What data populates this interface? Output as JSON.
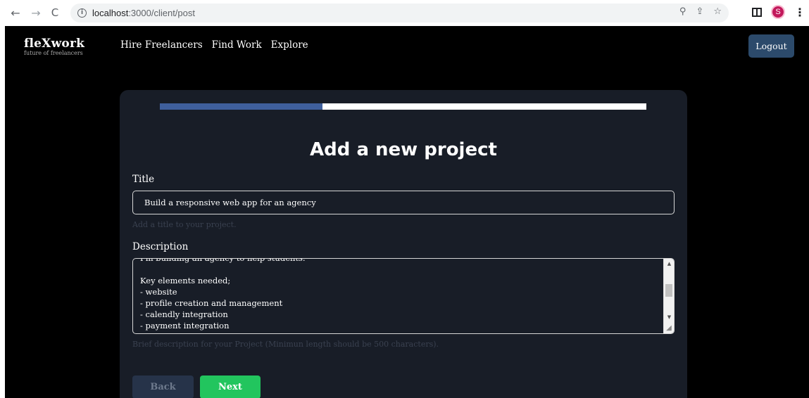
{
  "browser": {
    "url_host": "localhost",
    "url_path": ":3000/client/post",
    "avatar_letter": "S"
  },
  "app": {
    "brand_name": "fleXwork",
    "brand_tagline": "future of freelancers",
    "nav": [
      "Hire Freelancers",
      "Find Work",
      "Explore"
    ],
    "logout_label": "Logout"
  },
  "form": {
    "progress_fraction": 0.334,
    "heading": "Add a new project",
    "title_label": "Title",
    "title_value": "Build a responsive web app for an agency",
    "title_hint": "Add a title to your project.",
    "description_label": "Description",
    "description_value": "I'm building an agency to help students.\n\nKey elements needed;\n- website\n- profile creation and management\n- calendly integration\n- payment integration\n- app integration",
    "description_hint": "Brief description for your Project (Minimun length should be 500 characters).",
    "back_label": "Back",
    "next_label": "Next"
  },
  "colors": {
    "accent_next": "#22c55e",
    "progress_fill": "#3f5f9c",
    "logout_bg": "#2c4a6b",
    "card_bg": "#181d27"
  }
}
